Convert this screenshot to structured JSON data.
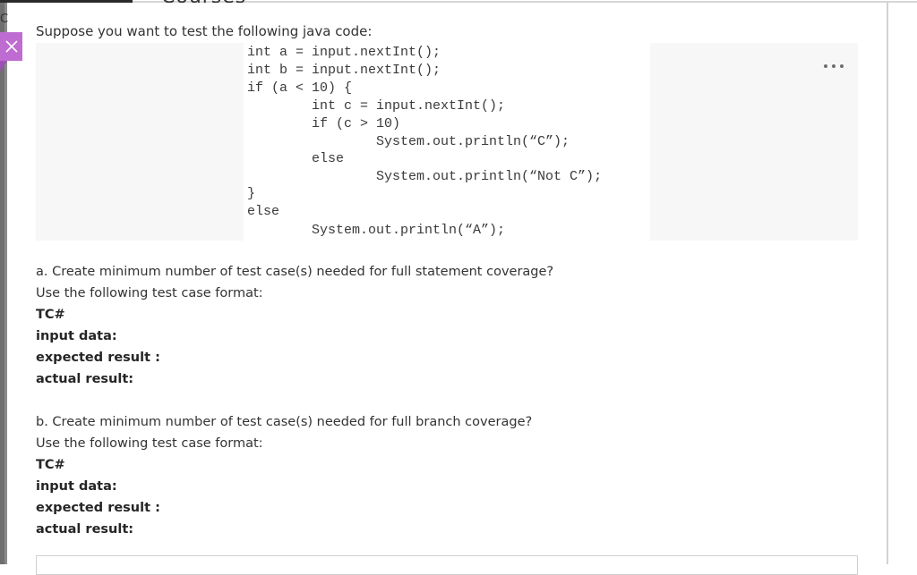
{
  "header": {
    "heading_fragment": "Courses",
    "side_letter": "C"
  },
  "icons": {
    "close": "close-icon",
    "more": "more-options-icon"
  },
  "colors": {
    "close_button_bg": "#bf6cd2",
    "code_bg": "#f7f7f7",
    "text": "#333333"
  },
  "question": {
    "intro": "Suppose you want to test the following java code:",
    "code_lines": [
      "int a = input.nextInt();",
      "int b = input.nextInt();",
      "if (a < 10) {",
      "        int c = input.nextInt();",
      "        if (c > 10)",
      "                System.out.println(“C”);",
      "        else",
      "                System.out.println(“Not C”);",
      "}",
      "else",
      "        System.out.println(“A”);"
    ],
    "part_a": {
      "prompt": "a. Create minimum number of test case(s) needed for full statement coverage?",
      "format_label": "Use the following test case format:",
      "fields": [
        "TC#",
        "input data:",
        "expected result :",
        "actual result:"
      ]
    },
    "part_b": {
      "prompt": "b. Create minimum number of test case(s) needed for full branch coverage?",
      "format_label": "Use the following test case format:",
      "fields": [
        "TC#",
        "input data:",
        "expected result :",
        "actual result:"
      ]
    }
  }
}
